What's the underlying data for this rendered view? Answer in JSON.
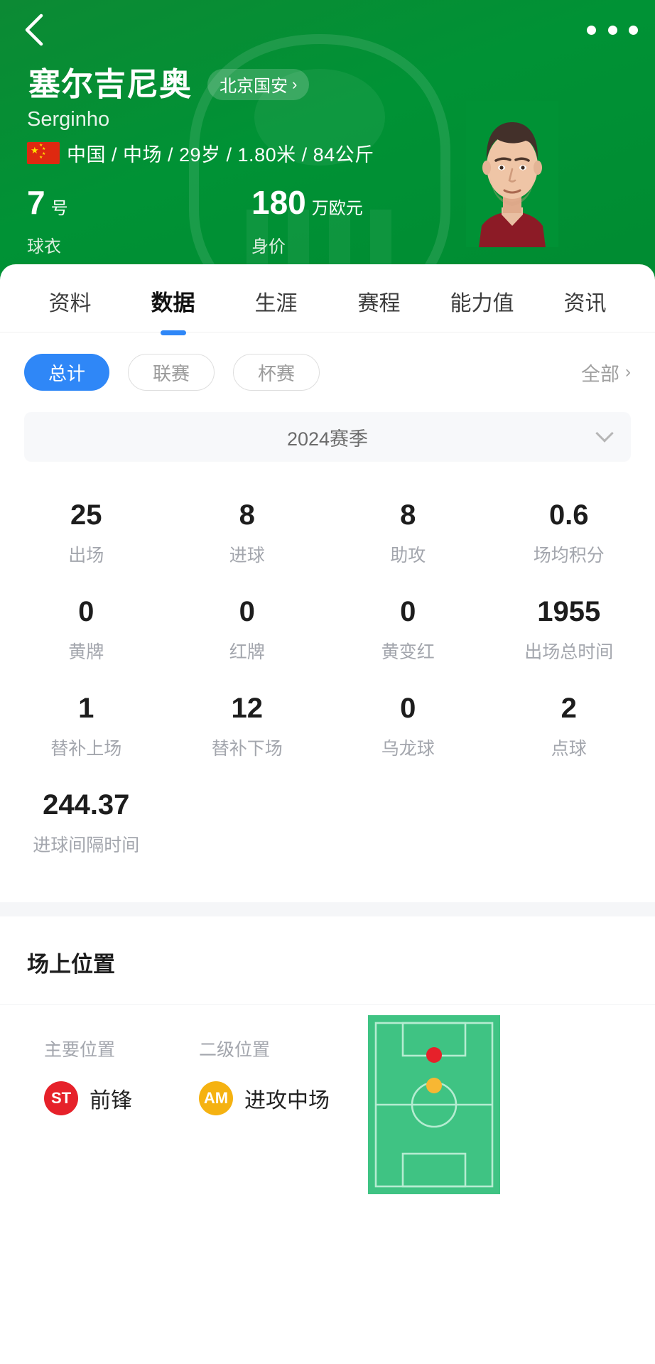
{
  "theme": {
    "brand_green": "#009235",
    "accent_blue": "#2f87f7",
    "pitch_green": "#3fc383",
    "st_red": "#e6212a",
    "am_yellow": "#f5b211"
  },
  "nav": {
    "back_icon": "chevron-left-icon",
    "more_icon": "more-horizontal-icon"
  },
  "player": {
    "name_cn": "塞尔吉尼奥",
    "name_en": "Serginho",
    "club": "北京国安",
    "club_chevron": "›",
    "nationality": "中国",
    "position": "中场",
    "age": "29岁",
    "height": "1.80米",
    "weight": "84公斤",
    "meta_line": "中国 / 中场 / 29岁 / 1.80米 / 84公斤",
    "shirt_number": "7",
    "shirt_unit": "号",
    "shirt_label": "球衣",
    "market_value": "180",
    "market_value_unit": "万欧元",
    "market_value_label": "身价"
  },
  "tabs": [
    {
      "label": "资料",
      "active": false
    },
    {
      "label": "数据",
      "active": true
    },
    {
      "label": "生涯",
      "active": false
    },
    {
      "label": "赛程",
      "active": false
    },
    {
      "label": "能力值",
      "active": false
    },
    {
      "label": "资讯",
      "active": false
    }
  ],
  "filters": {
    "pills": [
      {
        "label": "总计",
        "active": true
      },
      {
        "label": "联赛",
        "active": false
      },
      {
        "label": "杯赛",
        "active": false
      }
    ],
    "all_label": "全部",
    "all_chevron": "›"
  },
  "season": {
    "label": "2024赛季",
    "caret_icon": "chevron-down-icon"
  },
  "stats": [
    {
      "value": "25",
      "label": "出场"
    },
    {
      "value": "8",
      "label": "进球"
    },
    {
      "value": "8",
      "label": "助攻"
    },
    {
      "value": "0.6",
      "label": "场均积分"
    },
    {
      "value": "0",
      "label": "黄牌"
    },
    {
      "value": "0",
      "label": "红牌"
    },
    {
      "value": "0",
      "label": "黄变红"
    },
    {
      "value": "1955",
      "label": "出场总时间"
    },
    {
      "value": "1",
      "label": "替补上场"
    },
    {
      "value": "12",
      "label": "替补下场"
    },
    {
      "value": "0",
      "label": "乌龙球"
    },
    {
      "value": "2",
      "label": "点球"
    },
    {
      "value": "244.37",
      "label": "进球间隔时间"
    },
    {
      "value": "",
      "label": ""
    },
    {
      "value": "",
      "label": ""
    },
    {
      "value": "",
      "label": ""
    }
  ],
  "position_section": {
    "title": "场上位置",
    "primary": {
      "heading": "主要位置",
      "badge": "ST",
      "name": "前锋"
    },
    "secondary": {
      "heading": "二级位置",
      "badge": "AM",
      "name": "进攻中场"
    },
    "pitch": {
      "primary_dot_color": "#e6212a",
      "secondary_dot_color": "#f7b733"
    }
  }
}
